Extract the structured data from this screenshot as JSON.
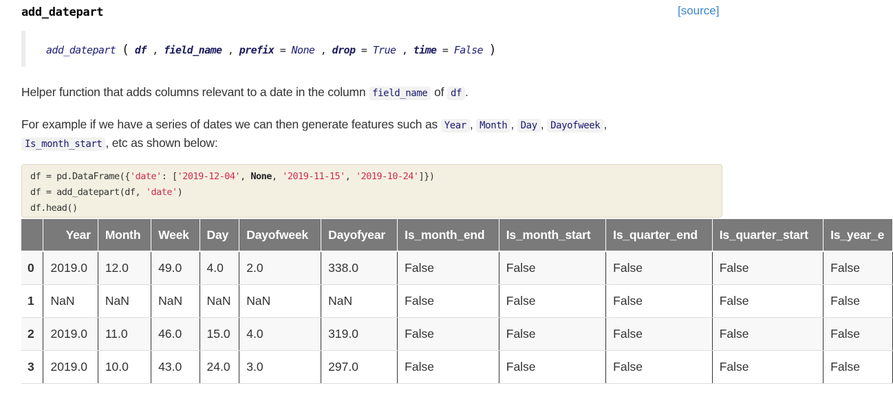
{
  "header": {
    "function_name": "add_datepart",
    "source_link": "[source]"
  },
  "signature": {
    "name": "add_datepart",
    "open_paren": "(",
    "close_paren": ")",
    "params": [
      {
        "name": "df",
        "default": null
      },
      {
        "name": "field_name",
        "default": null
      },
      {
        "name": "prefix",
        "default": "None"
      },
      {
        "name": "drop",
        "default": "True"
      },
      {
        "name": "time",
        "default": "False"
      }
    ],
    "separator": ",",
    "equals": "="
  },
  "description": {
    "line1_text": "Helper function that adds columns relevant to a date in the column",
    "line1_code1": "field_name",
    "line1_mid": "of",
    "line1_code2": "df",
    "line1_end": ".",
    "line2_text": "For example if we have a series of dates we can then generate features such as",
    "line2_codes": [
      "Year",
      "Month",
      "Day",
      "Dayofweek"
    ],
    "line3_code": "Is_month_start",
    "line3_text": ", etc as shown below:"
  },
  "code_example": {
    "line1": {
      "a": "df = pd.DataFrame({",
      "s1": "'date'",
      "b": ": [",
      "s2": "'2019-12-04'",
      "c": ", ",
      "kw": "None",
      "d": ", ",
      "s3": "'2019-11-15'",
      "e": ", ",
      "s4": "'2019-10-24'",
      "f": "]})"
    },
    "line2": {
      "a": "df = add_datepart(df, ",
      "s1": "'date'",
      "b": ")"
    },
    "line3": "df.head()"
  },
  "table": {
    "columns": [
      "",
      "Year",
      "Month",
      "Week",
      "Day",
      "Dayofweek",
      "Dayofyear",
      "Is_month_end",
      "Is_month_start",
      "Is_quarter_end",
      "Is_quarter_start",
      "Is_year_e"
    ],
    "rows": [
      [
        "0",
        "2019.0",
        "12.0",
        "49.0",
        "4.0",
        "2.0",
        "338.0",
        "False",
        "False",
        "False",
        "False",
        "False"
      ],
      [
        "1",
        "NaN",
        "NaN",
        "NaN",
        "NaN",
        "NaN",
        "NaN",
        "False",
        "False",
        "False",
        "False",
        "False"
      ],
      [
        "2",
        "2019.0",
        "11.0",
        "46.0",
        "15.0",
        "4.0",
        "319.0",
        "False",
        "False",
        "False",
        "False",
        "False"
      ],
      [
        "3",
        "2019.0",
        "10.0",
        "43.0",
        "24.0",
        "3.0",
        "297.0",
        "False",
        "False",
        "False",
        "False",
        "False"
      ]
    ]
  }
}
